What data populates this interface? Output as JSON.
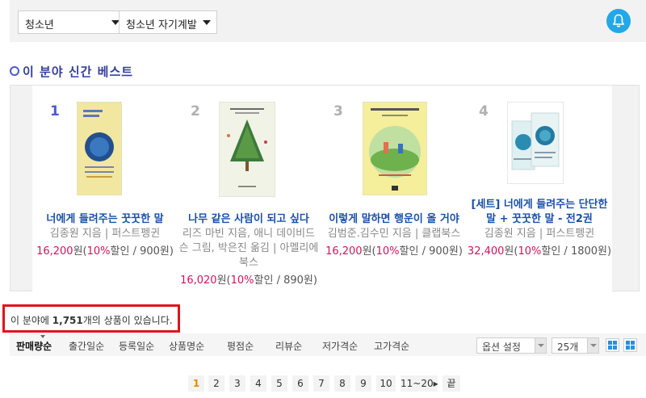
{
  "filters": {
    "category_select": "청소년",
    "subcategory_select": "청소년 자기계발"
  },
  "section": {
    "title": "이 분야 신간 베스트"
  },
  "best_items": [
    {
      "rank": "1",
      "title_lines": [
        "너에게 들려주는 꿋꿋한 말"
      ],
      "author_lines": [
        "김종원 지음 | 퍼스트펭귄"
      ],
      "price": "16,200",
      "won": "원(",
      "rate": "10%",
      "discount": "할인 / 900원)",
      "colors": {
        "cover_bg": "#f2e7a0",
        "accent": "#2f5f9e"
      }
    },
    {
      "rank": "2",
      "title_lines": [
        "나무 같은 사람이 되고 싶다"
      ],
      "author_lines": [
        "리즈 마빈 지음, 애니 데이비드",
        "슨 그림, 박은진 옮김 | 아멜리에",
        "북스"
      ],
      "price": "16,020",
      "won": "원(",
      "rate": "10%",
      "discount": "할인 / 890원)",
      "colors": {
        "cover_bg": "#f1f3e6",
        "accent": "#3d7a3a"
      }
    },
    {
      "rank": "3",
      "title_lines": [
        "이렇게 말하면 행운이 올 거야"
      ],
      "author_lines": [
        "김범준.김수민 지음 | 클랩북스"
      ],
      "price": "16,200",
      "won": "원(",
      "rate": "10%",
      "discount": "할인 / 900원)",
      "colors": {
        "cover_bg": "#f5ee9b",
        "accent": "#6fb24d"
      }
    },
    {
      "rank": "4",
      "title_lines": [
        "[세트] 너에게 들려주는 단단한",
        "말 + 꿋꿋한 말 - 전2권"
      ],
      "author_lines": [
        "김종원 지음 | 퍼스트펭귄"
      ],
      "price": "32,400",
      "won": "원(",
      "rate": "10%",
      "discount": "할인 / 1800원)",
      "colors": {
        "cover_bg": "#dff0f2",
        "accent": "#2a8cb0"
      }
    }
  ],
  "count_notice": {
    "prefix": "이 분야에 ",
    "count": "1,751",
    "suffix": "개의 상품이 있습니다."
  },
  "sort_options": [
    "판매량순",
    "출간일순",
    "등록일순",
    "상품명순",
    "평점순",
    "리뷰순",
    "저가격순",
    "고가격순"
  ],
  "sort_active": "판매량순",
  "option_select": "옵션 설정",
  "per_page_select": "25개",
  "pagination": [
    "1",
    "2",
    "3",
    "4",
    "5",
    "6",
    "7",
    "8",
    "9",
    "10",
    "11~20▸",
    "끝"
  ],
  "current_page": "1",
  "colors": {
    "title_blue": "#333f9d",
    "link_blue": "#1a4fa8",
    "price_red": "#d0145a",
    "notice_border": "#e0141c",
    "bell_blue": "#22a8e8",
    "page_current": "#e8860c"
  }
}
